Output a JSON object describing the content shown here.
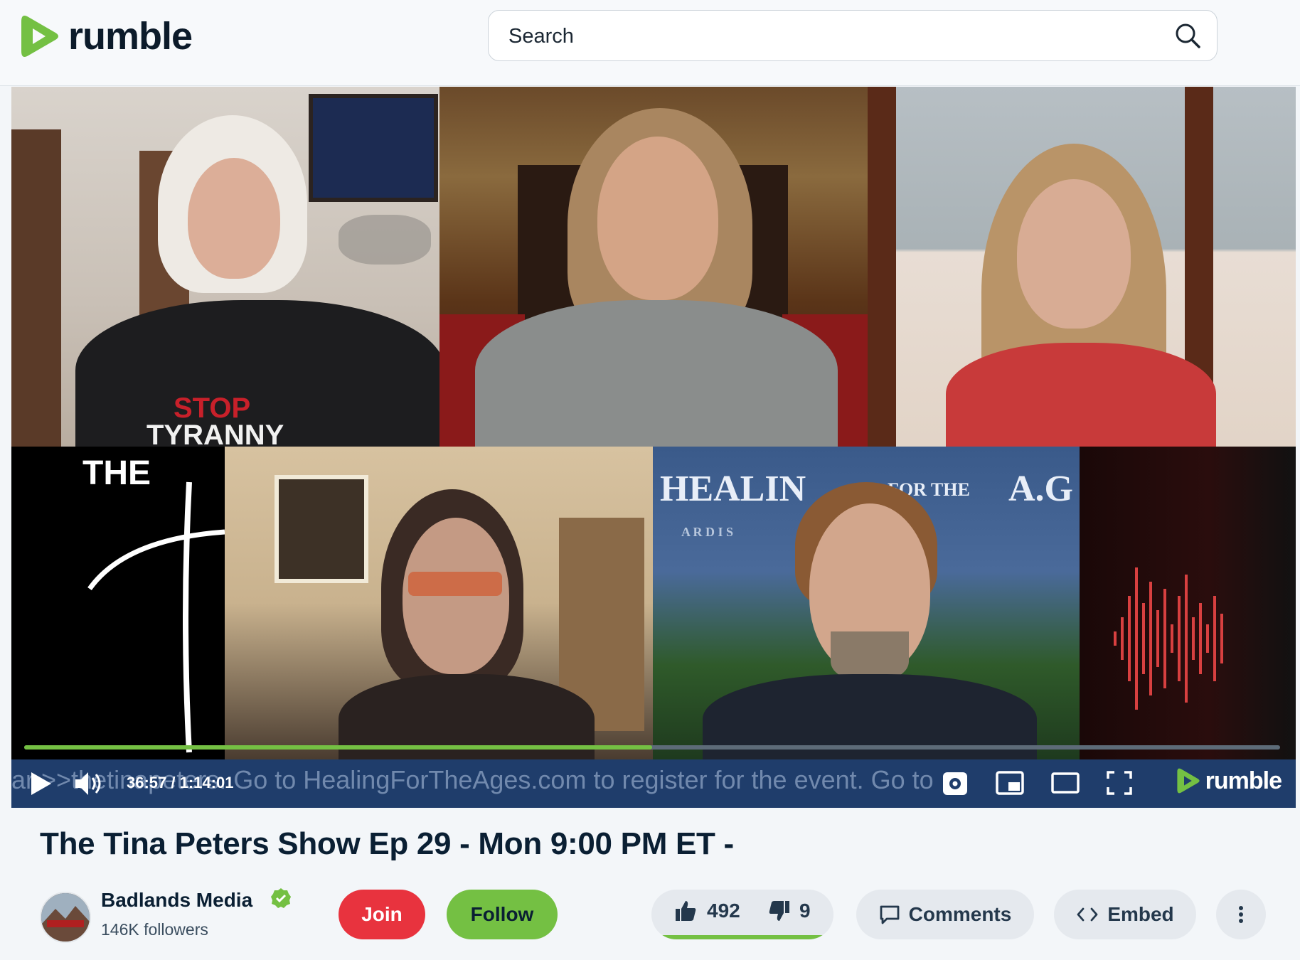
{
  "header": {
    "brand": "rumble",
    "search_placeholder": "Search"
  },
  "player": {
    "ticker": "ar >>thetinapeters. Go to HealingForTheAges.com to register for the event. Go to",
    "time": "36:57 / 1:14:01",
    "progress": 0.5,
    "brand": "rumble",
    "tile_text": {
      "the": "THE",
      "healing": "HEALIN",
      "for_the": "FOR THE",
      "ages": "A.G",
      "sub": "A R D I S",
      "stop": "STOP",
      "tyranny": "TYRANNY"
    }
  },
  "video": {
    "title": "The Tina Peters Show Ep 29 - Mon 9:00 PM ET -",
    "channel_name": "Badlands Media",
    "followers": "146K followers",
    "join_label": "Join",
    "follow_label": "Follow",
    "likes": "492",
    "dislikes": "9",
    "comments_label": "Comments",
    "embed_label": "Embed"
  },
  "colors": {
    "accent": "#74c043",
    "join": "#e8333e",
    "controls_bg": "#1f3d6b"
  }
}
